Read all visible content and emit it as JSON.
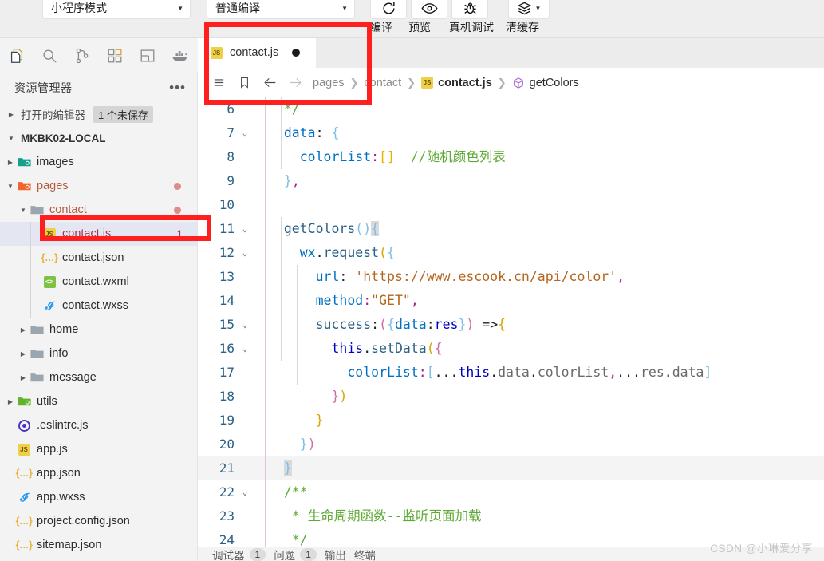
{
  "toolbar": {
    "mode_select": "小程序模式",
    "compile_select": "普通编译",
    "buttons": [
      {
        "name": "compile",
        "label": "编译",
        "icon": "refresh-icon"
      },
      {
        "name": "preview",
        "label": "预览",
        "icon": "eye-icon"
      },
      {
        "name": "realdevice",
        "label": "真机调试",
        "icon": "bug-icon"
      },
      {
        "name": "clearcache",
        "label": "清缓存",
        "icon": "layers-icon"
      }
    ]
  },
  "activitybar": {
    "icons": [
      "files-icon",
      "search-icon",
      "source-control-icon",
      "extensions-icon",
      "split-layout-icon",
      "docker-icon"
    ]
  },
  "sidebar": {
    "title": "资源管理器",
    "more_label": "•••",
    "open_editors": {
      "label": "打开的编辑器",
      "badge": "1 个未保存"
    },
    "root": "MKBK02-LOCAL",
    "tree": [
      {
        "name": "images",
        "type": "folder",
        "depth": 1,
        "twisty": "▶",
        "icon": "folder-images-icon"
      },
      {
        "name": "pages",
        "type": "folder",
        "depth": 1,
        "twisty": "▼",
        "icon": "folder-pages-icon",
        "modified": true,
        "dirty": true
      },
      {
        "name": "contact",
        "type": "folder",
        "depth": 2,
        "twisty": "▼",
        "icon": "folder-icon",
        "modified": true,
        "dirty": true
      },
      {
        "name": "contact.js",
        "type": "js",
        "depth": 3,
        "twisty": "",
        "icon": "js-file-icon",
        "selected": true,
        "error": true,
        "count": "1"
      },
      {
        "name": "contact.json",
        "type": "json",
        "depth": 3,
        "twisty": "",
        "icon": "json-file-icon"
      },
      {
        "name": "contact.wxml",
        "type": "wxml",
        "depth": 3,
        "twisty": "",
        "icon": "wxml-file-icon"
      },
      {
        "name": "contact.wxss",
        "type": "wxss",
        "depth": 3,
        "twisty": "",
        "icon": "wxss-file-icon"
      },
      {
        "name": "home",
        "type": "folder",
        "depth": 2,
        "twisty": "▶",
        "icon": "folder-icon"
      },
      {
        "name": "info",
        "type": "folder",
        "depth": 2,
        "twisty": "▶",
        "icon": "folder-icon"
      },
      {
        "name": "message",
        "type": "folder",
        "depth": 2,
        "twisty": "▶",
        "icon": "folder-icon"
      },
      {
        "name": "utils",
        "type": "folder",
        "depth": 1,
        "twisty": "▶",
        "icon": "folder-utils-icon"
      },
      {
        "name": ".eslintrc.js",
        "type": "eslint",
        "depth": 1,
        "twisty": "",
        "icon": "eslint-file-icon"
      },
      {
        "name": "app.js",
        "type": "js",
        "depth": 1,
        "twisty": "",
        "icon": "js-file-icon"
      },
      {
        "name": "app.json",
        "type": "json",
        "depth": 1,
        "twisty": "",
        "icon": "json-file-icon"
      },
      {
        "name": "app.wxss",
        "type": "wxss",
        "depth": 1,
        "twisty": "",
        "icon": "wxss-file-icon"
      },
      {
        "name": "project.config.json",
        "type": "json",
        "depth": 1,
        "twisty": "",
        "icon": "json-file-icon"
      },
      {
        "name": "sitemap.json",
        "type": "json",
        "depth": 1,
        "twisty": "",
        "icon": "json-file-icon"
      }
    ]
  },
  "editor": {
    "tab": {
      "label": "contact.js",
      "icon": "js-file-icon",
      "dirty": true
    },
    "breadcrumb": {
      "menu_icon": "hamburger-icon",
      "bookmark_icon": "bookmark-icon",
      "back_icon": "arrow-left-icon",
      "forward_icon": "arrow-right-icon",
      "segments": [
        "pages",
        "contact",
        "contact.js",
        "getColors"
      ],
      "separator": "❯"
    },
    "lines": [
      {
        "no": "6",
        "fold": "",
        "text": "  */"
      },
      {
        "no": "7",
        "fold": "⌄",
        "text": "  data: {"
      },
      {
        "no": "8",
        "fold": "",
        "text": "    colorList:[]  //随机颜色列表"
      },
      {
        "no": "9",
        "fold": "",
        "text": "  },"
      },
      {
        "no": "10",
        "fold": "",
        "text": ""
      },
      {
        "no": "11",
        "fold": "⌄",
        "text": "  getColors(){"
      },
      {
        "no": "12",
        "fold": "⌄",
        "text": "    wx.request({"
      },
      {
        "no": "13",
        "fold": "",
        "text": "      url: 'https://www.escook.cn/api/color',"
      },
      {
        "no": "14",
        "fold": "",
        "text": "      method:\"GET\","
      },
      {
        "no": "15",
        "fold": "⌄",
        "text": "      success:({data:res}) =>{"
      },
      {
        "no": "16",
        "fold": "⌄",
        "text": "        this.setData({"
      },
      {
        "no": "17",
        "fold": "",
        "text": "          colorList:[...this.data.colorList,...res.data]"
      },
      {
        "no": "18",
        "fold": "",
        "text": "        })"
      },
      {
        "no": "19",
        "fold": "",
        "text": "      }"
      },
      {
        "no": "20",
        "fold": "",
        "text": "    })"
      },
      {
        "no": "21",
        "fold": "",
        "text": "  }"
      },
      {
        "no": "22",
        "fold": "⌄",
        "text": "  /**"
      },
      {
        "no": "23",
        "fold": "",
        "text": "   * 生命周期函数--监听页面加载"
      },
      {
        "no": "24",
        "fold": "",
        "text": "   */"
      }
    ],
    "url_value": "https://www.escook.cn/api/color",
    "comment_colorlist": "//随机颜色列表",
    "comment_lifecycle": "* 生命周期函数--监听页面加载"
  },
  "panel": {
    "items": [
      {
        "label": "调试器",
        "count": "1"
      },
      {
        "label": "问题",
        "count": "1"
      },
      {
        "label": "输出",
        "count": ""
      },
      {
        "label": "终端",
        "count": ""
      }
    ]
  },
  "watermark": "CSDN @小琳爱分享",
  "colors": {
    "accent_red": "#ff1f1f",
    "js_yellow": "#f0cf4a",
    "comment_green": "#5faa36",
    "string_orange": "#b5651d",
    "selected_row": "#e4e6f1"
  }
}
